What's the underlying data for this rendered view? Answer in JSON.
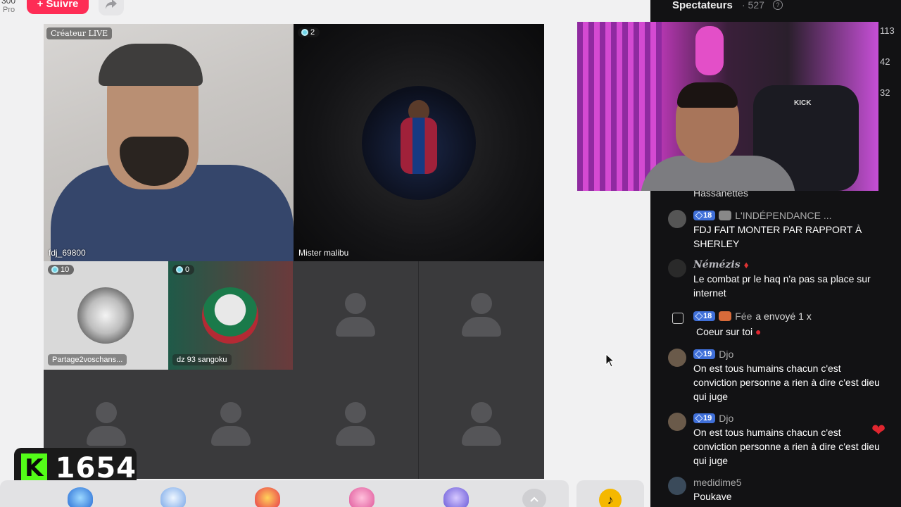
{
  "top": {
    "follower_count": "300",
    "pro_label": "Pro",
    "follow_label": "+ Suivre"
  },
  "grid": {
    "creator_badge": "Créateur LIVE",
    "tiles": [
      {
        "name": "fdj_69800",
        "count": ""
      },
      {
        "name": "Mister malibu",
        "count": "2"
      },
      {
        "name": "Partage2voschans...",
        "count": "10"
      },
      {
        "name": "dz 93 sangoku",
        "count": "0"
      }
    ]
  },
  "overlay": {
    "k_value": "1654",
    "k_letter": "K"
  },
  "spectators": {
    "title": "Spectateurs",
    "count": "· 527",
    "ranks": [
      "113",
      "42",
      "32"
    ]
  },
  "chat": {
    "partial_name": "Hassanettes",
    "messages": [
      {
        "level": "18",
        "name": "L'INDÉPENDANCE ...",
        "text": "FDJ FAIT MONTER PAR RAPPORT À SHERLEY"
      },
      {
        "level": "",
        "name": "Némézis",
        "text": "Le combat pr le haq n'a pas sa place sur internet"
      },
      {
        "level": "18",
        "name": "Fée",
        "action": "a envoyé 1 x",
        "text": "Coeur sur toi"
      },
      {
        "level": "19",
        "name": "Djo",
        "text": "On est tous humains chacun c'est conviction personne a rien à dire c'est dieu qui juge"
      },
      {
        "level": "19",
        "name": "Djo",
        "text": "On est tous humains chacun c'est conviction personne a rien à dire c'est dieu qui juge"
      },
      {
        "level": "",
        "name": "medidime5",
        "text": "Poukave"
      }
    ]
  },
  "colors": {
    "follow": "#fe2c55",
    "kick_green": "#53fc18",
    "level_badge": "#3f6fd8",
    "panel_bg": "#121214"
  }
}
